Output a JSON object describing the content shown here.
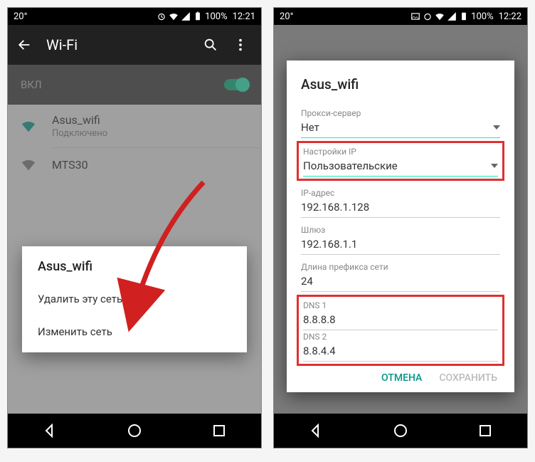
{
  "left": {
    "status": {
      "temp": "20°",
      "battery": "100%",
      "time": "12:21"
    },
    "title": "Wi-Fi",
    "toggle_label": "ВКЛ",
    "network": {
      "name": "Asus_wifi",
      "status": "Подключено"
    },
    "network2": {
      "name": "MTS30"
    },
    "ctx": {
      "title": "Asus_wifi",
      "forget": "Удалить эту сеть",
      "modify": "Изменить сеть"
    }
  },
  "right": {
    "status": {
      "temp": "20°",
      "battery": "100%",
      "time": "12:22"
    },
    "dlg": {
      "title": "Asus_wifi",
      "proxy_label": "Прокси-сервер",
      "proxy_value": "Нет",
      "ip_label": "Настройки IP",
      "ip_value": "Пользовательские",
      "ipaddr_label": "IP-адрес",
      "ipaddr_value": "192.168.1.128",
      "gateway_label": "Шлюз",
      "gateway_value": "192.168.1.1",
      "prefix_label": "Длина префикса сети",
      "prefix_value": "24",
      "dns1_label": "DNS 1",
      "dns1_value": "8.8.8.8",
      "dns2_label": "DNS 2",
      "dns2_value": "8.8.4.4",
      "cancel": "ОТМЕНА",
      "save": "СОХРАНИТЬ"
    }
  }
}
